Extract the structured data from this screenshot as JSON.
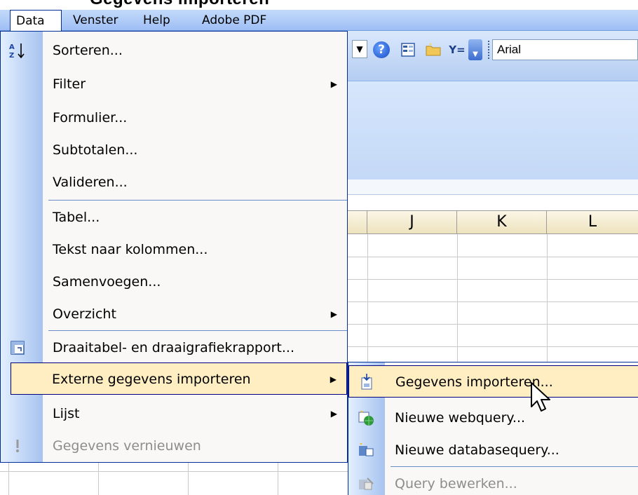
{
  "title": "Gegevens importeren",
  "menubar": {
    "items": [
      {
        "label": "Data"
      },
      {
        "label": "Venster"
      },
      {
        "label": "Help"
      },
      {
        "label": "Adobe PDF"
      }
    ]
  },
  "toolbar": {
    "font_name": "Arial",
    "icons": [
      "dropdown-arrow-icon",
      "help-icon",
      "form-icon",
      "folder-icon",
      "autofilter-icon",
      "toolbar-options-icon"
    ]
  },
  "columns": [
    "J",
    "K",
    "L"
  ],
  "data_menu": {
    "items": [
      {
        "label": "Sorteren...",
        "icon": "sort-az-icon",
        "has_submenu": false
      },
      {
        "label": "Filter",
        "icon": "",
        "has_submenu": true
      },
      {
        "label": "Formulier...",
        "icon": "",
        "has_submenu": false
      },
      {
        "label": "Subtotalen...",
        "icon": "",
        "has_submenu": false
      },
      {
        "label": "Valideren...",
        "icon": "",
        "has_submenu": false
      },
      {
        "label": "Tabel...",
        "icon": "",
        "has_submenu": false
      },
      {
        "label": "Tekst naar kolommen...",
        "icon": "",
        "has_submenu": false
      },
      {
        "label": "Samenvoegen...",
        "icon": "",
        "has_submenu": false
      },
      {
        "label": "Overzicht",
        "icon": "",
        "has_submenu": true
      },
      {
        "label": "Draaitabel- en draaigrafiekrapport...",
        "icon": "pivot-table-icon",
        "has_submenu": false
      },
      {
        "label": "Externe gegevens importeren",
        "icon": "",
        "has_submenu": true,
        "highlighted": true
      },
      {
        "label": "Lijst",
        "icon": "",
        "has_submenu": true
      },
      {
        "label": "Gegevens vernieuwen",
        "icon": "refresh-icon",
        "has_submenu": false,
        "disabled": true
      }
    ]
  },
  "sub_menu": {
    "items": [
      {
        "label": "Gegevens importeren...",
        "icon": "import-data-icon",
        "highlighted": true
      },
      {
        "label": "Nieuwe webquery...",
        "icon": "web-query-icon"
      },
      {
        "label": "Nieuwe databasequery...",
        "icon": "database-query-icon"
      },
      {
        "label": "Query bewerken...",
        "icon": "edit-query-icon",
        "disabled": true
      }
    ]
  },
  "colors": {
    "menu_highlight": "#ffeec2",
    "menu_border": "#002d96",
    "menubar_bg": "#c3daf9",
    "disabled_text": "#8d8d8d"
  }
}
